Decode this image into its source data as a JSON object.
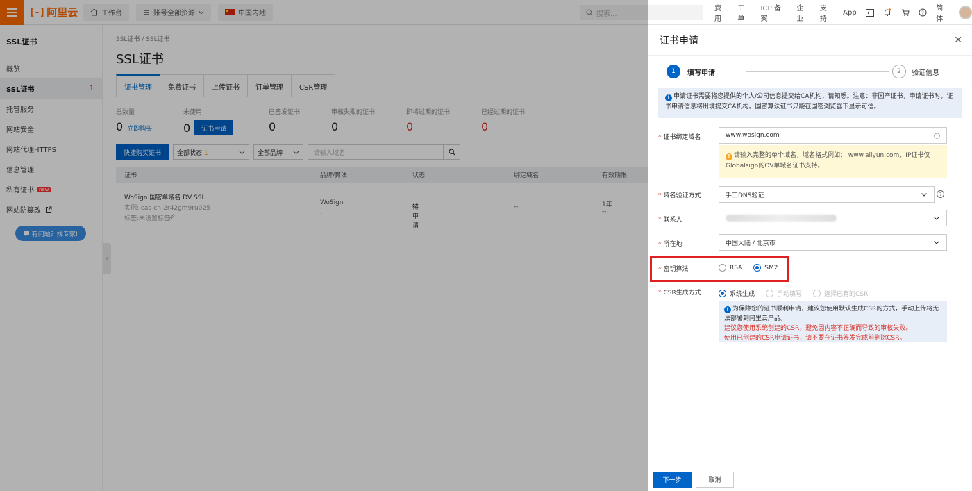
{
  "topbar": {
    "logo_text": "阿里云",
    "workbench": "工作台",
    "resources": "账号全部资源",
    "region": "中国内地",
    "search_placeholder": "搜索...",
    "links": [
      "费用",
      "工单",
      "ICP 备案",
      "企业",
      "支持",
      "App"
    ],
    "lang": "简体",
    "brand_color": "#ff6a00"
  },
  "sidebar": {
    "title": "SSL证书",
    "items": [
      {
        "label": "概览"
      },
      {
        "label": "SSL证书",
        "count": "1"
      },
      {
        "label": "托管服务"
      },
      {
        "label": "网站安全"
      },
      {
        "label": "网站代理HTTPS"
      },
      {
        "label": "信息管理"
      },
      {
        "label": "私有证书",
        "badge": "new"
      },
      {
        "label": "网站防篡改"
      }
    ],
    "help_label": "有问题？找专家!"
  },
  "main": {
    "breadcrumb": "SSL证书  /  SSL证书",
    "title": "SSL证书",
    "tabs": [
      "证书管理",
      "免费证书",
      "上传证书",
      "订单管理",
      "CSR管理"
    ],
    "stats": {
      "total": {
        "label": "总数量",
        "value": "0",
        "link": "立即购买"
      },
      "unused": {
        "label": "未使用",
        "value": "0",
        "button": "证书申请"
      },
      "issued": {
        "label": "已签发证书",
        "value": "0"
      },
      "failed": {
        "label": "审核失败的证书",
        "value": "0"
      },
      "expiring": {
        "label": "即将过期的证书",
        "value": "0"
      },
      "expired": {
        "label": "已经过期的证书",
        "value": "0"
      }
    },
    "toolbar": {
      "buy_button": "快捷购买证书",
      "status_select": "全部状态",
      "status_count": "1",
      "brand_select": "全部品牌",
      "search_placeholder": "请输入域名"
    },
    "table": {
      "headers": [
        "证书",
        "品牌/算法",
        "状态",
        "绑定域名",
        "有效期限"
      ],
      "rows": [
        {
          "name": "WoSign 国密单域名 DV SSL",
          "instance": "实例: cas-cn-2r42gm9ru025",
          "tag": "标签:未设置标签",
          "brand": "WoSign",
          "brand_sub": "-",
          "status": "待申请",
          "domain": "--",
          "period": "1年",
          "period_sub": "--"
        }
      ]
    }
  },
  "drawer": {
    "title": "证书申请",
    "steps": [
      {
        "num": "1",
        "label": "填写申请"
      },
      {
        "num": "2",
        "label": "验证信息"
      }
    ],
    "notice": "申请证书需要将您提供的个人/公司信息提交给CA机构，请知悉。注意：非国产证书，申请证书时，证书申请信息将出境提交CA机构。国密算法证书只能在国密浏览器下显示可信。",
    "form": {
      "domain_label": "证书绑定域名",
      "domain_value": "www.wosign.com",
      "domain_tip": "请输入完整的单个域名，域名格式例如：  www.aliyun.com，IP证书仅Globalsign的OV单域名证书支持。",
      "verify_label": "域名验证方式",
      "verify_value": "手工DNS验证",
      "contact_label": "联系人",
      "location_label": "所在地",
      "location_value": "中国大陆 / 北京市",
      "algo_label": "密钥算法",
      "algo_options": [
        "RSA",
        "SM2"
      ],
      "algo_selected": "SM2",
      "csr_label": "CSR生成方式",
      "csr_options": [
        "系统生成",
        "手动填写",
        "选择已有的CSR"
      ],
      "csr_selected": "系统生成",
      "csr_tip_1": "为保障您的证书顺利申请，建议您使用默认生成CSR的方式，手动上传将无法部署到阿里云产品。",
      "csr_tip_2": "建议您使用系统创建的CSR，避免因内容不正确而导致的审核失败。",
      "csr_tip_3": "使用已创建的CSR申请证书，请不要在证书签发完成前删除CSR。"
    },
    "footer": {
      "next": "下一步",
      "cancel": "取消"
    }
  }
}
